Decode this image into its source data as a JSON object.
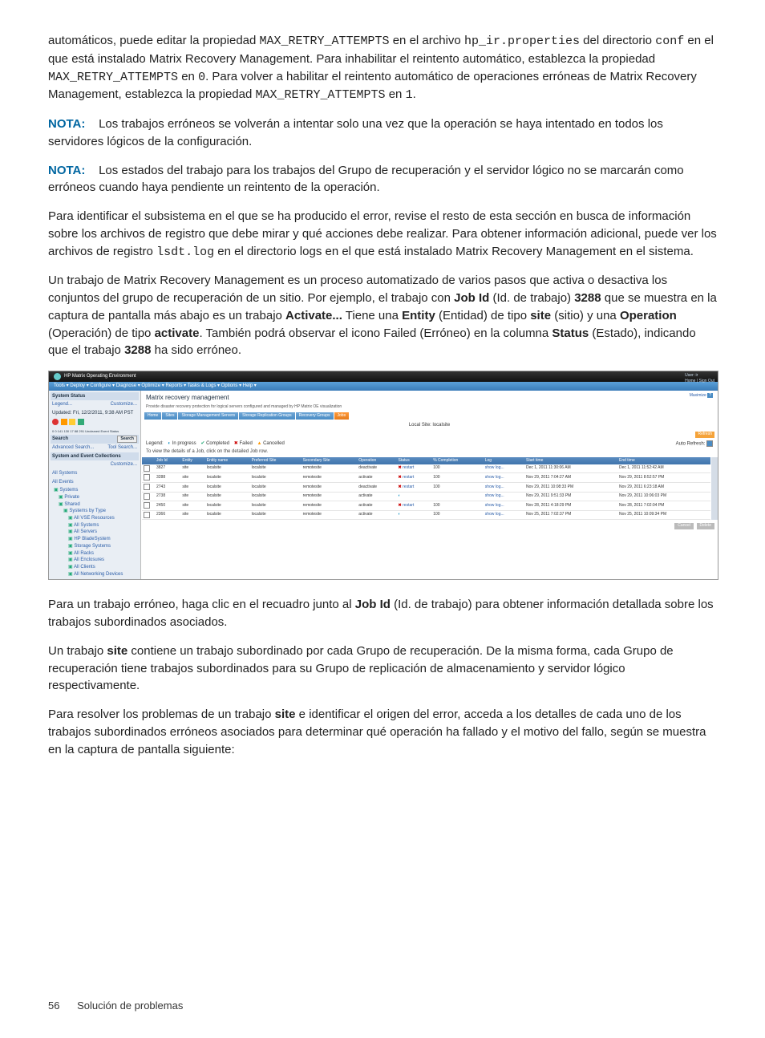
{
  "para1_a": "automáticos, puede editar la propiedad ",
  "para1_code1": "MAX_RETRY_ATTEMPTS",
  "para1_b": " en el archivo ",
  "para1_code2": "hp_ir.properties",
  "para1_c": " del directorio ",
  "para1_code3": "conf",
  "para1_d": " en el que está instalado Matrix Recovery Management. Para inhabilitar el reintento automático, establezca la propiedad ",
  "para1_code4": "MAX_RETRY_ATTEMPTS",
  "para1_e": " en ",
  "para1_code5": "0",
  "para1_f": ". Para volver a habilitar el reintento automático de operaciones erróneas de Matrix Recovery Management, establezca la propiedad ",
  "para1_code6": "MAX_RETRY_ATTEMPTS",
  "para1_g": " en ",
  "para1_code7": "1",
  "para1_h": ".",
  "nota_label": "NOTA:",
  "nota1_text": " Los trabajos erróneos se volverán a intentar solo una vez que la operación se haya intentado en todos los servidores lógicos de la configuración.",
  "nota2_text": " Los estados del trabajo para los trabajos del Grupo de recuperación y el servidor lógico no se marcarán como erróneos cuando haya pendiente un reintento de la operación.",
  "para2_a": "Para identificar el subsistema en el que se ha producido el error, revise el resto de esta sección en busca de información sobre los archivos de registro que debe mirar y qué acciones debe realizar. Para obtener información adicional, puede ver los archivos de registro ",
  "para2_code1": "lsdt.log",
  "para2_b": " en el directorio logs en el que está instalado Matrix Recovery Management en el sistema.",
  "para3_a": "Un trabajo de Matrix Recovery Management es un proceso automatizado de varios pasos que activa o desactiva los conjuntos del grupo de recuperación de un sitio. Por ejemplo, el trabajo con ",
  "para3_b1": "Job Id",
  "para3_c": " (Id. de trabajo) ",
  "para3_b2": "3288",
  "para3_d": " que se muestra en la captura de pantalla más abajo es un trabajo ",
  "para3_b3": "Activate...",
  "para3_e": " Tiene una ",
  "para3_b4": "Entity",
  "para3_f": " (Entidad) de tipo ",
  "para3_b5": "site",
  "para3_g": " (sitio) y una ",
  "para3_b6": "Operation",
  "para3_h": " (Operación) de tipo ",
  "para3_b7": "activate",
  "para3_i": ". También podrá observar el icono Failed (Erróneo) en la columna ",
  "para3_b8": "Status",
  "para3_j": " (Estado), indicando que el trabajo ",
  "para3_b9": "3288",
  "para3_k": " ha sido erróneo.",
  "ss": {
    "app_title": "HP Matrix Operating Environment",
    "user": "User: ir",
    "user_links": "Home | Sign Out",
    "menubar": "Tools ▾   Deploy ▾   Configure ▾   Diagnose ▾   Optimize ▾   Reports ▾   Tasks & Logs ▾   Options ▾   Help ▾",
    "side_status": "System Status",
    "side_legend": "Legend...",
    "side_custom": "Customize...",
    "side_updated": "Updated: Fri, 12/2/2011, 9:38 AM PST",
    "side_counts": "0 0 141 130 17 88 291 Uncleared Event Status",
    "side_search": "Search",
    "side_search_btn": "Search",
    "side_adv": "Advanced Search...",
    "side_tool": "Tool Search...",
    "side_collections": "System and Event Collections",
    "side_customize": "Customize...",
    "side_all_sys": "All Systems",
    "side_all_ev": "All Events",
    "tree": {
      "systems": "Systems",
      "private": "Private",
      "shared": "Shared",
      "by_type": "Systems by Type",
      "vse": "All VSE Resources",
      "all_sys": "All Systems",
      "servers": "All Servers",
      "blades": "HP BladeSystem",
      "storage": "Storage Systems",
      "racks": "All Racks",
      "enclosures": "All Enclosures",
      "clients": "All Clients",
      "netdev": "All Networking Devices"
    },
    "main_title": "Matrix recovery management",
    "main_sub": "Provide disaster recovery protection for logical servers configured and managed by HP Matrix OE visualization",
    "maximize": "Maximize",
    "tabs": [
      "Home",
      "Sites",
      "Storage Management Servers",
      "Storage Replication Groups",
      "Recovery Groups",
      "Jobs"
    ],
    "local_site": "Local Site: localsite",
    "refresh_btn": "Refresh",
    "auto_refresh": "Auto Refresh:",
    "legend": {
      "label": "Legend:",
      "in_progress": "In progress",
      "completed": "Completed",
      "failed": "Failed",
      "cancelled": "Cancelled"
    },
    "hint": "To view the details of a Job, click on the detailed Job row.",
    "columns": [
      "Job Id",
      "Entity",
      "Entity name",
      "Preferred Site",
      "Secondary Site",
      "Operation",
      "Status",
      "% Completion",
      "Log",
      "Start time",
      "End time"
    ],
    "rows": [
      {
        "id": "3827",
        "entity": "site",
        "ename": "localsite",
        "pref": "localsite",
        "sec": "remotesite",
        "op": "deactivate",
        "status": "fail",
        "status_text": "restart",
        "pct": "100",
        "log": "show log...",
        "start": "Dec 1, 2011 11:30:06 AM",
        "end": "Dec 1, 2011 11:52:42 AM"
      },
      {
        "id": "3288",
        "entity": "site",
        "ename": "localsite",
        "pref": "localsite",
        "sec": "remotesite",
        "op": "activate",
        "status": "fail",
        "status_text": "restart",
        "pct": "100",
        "log": "show log...",
        "start": "Nov 29, 2011 7:04:27 AM",
        "end": "Nov 29, 2011 8:52:57 PM"
      },
      {
        "id": "2743",
        "entity": "site",
        "ename": "localsite",
        "pref": "localsite",
        "sec": "remotesite",
        "op": "deactivate",
        "status": "fail",
        "status_text": "restart",
        "pct": "100",
        "log": "show log...",
        "start": "Nov 29, 2011 10:08:33 PM",
        "end": "Nov 29, 2011 6:23:18 AM"
      },
      {
        "id": "2738",
        "entity": "site",
        "ename": "localsite",
        "pref": "localsite",
        "sec": "remotesite",
        "op": "activate",
        "status": "run",
        "status_text": "",
        "pct": "",
        "log": "show log...",
        "start": "Nov 29, 2011 9:51:33 PM",
        "end": "Nov 29, 2011 10:06:03 PM"
      },
      {
        "id": "2450",
        "entity": "site",
        "ename": "localsite",
        "pref": "localsite",
        "sec": "remotesite",
        "op": "activate",
        "status": "fail",
        "status_text": "restart",
        "pct": "100",
        "log": "show log...",
        "start": "Nov 28, 2011 4:18:29 PM",
        "end": "Nov 28, 2011 7:02:04 PM"
      },
      {
        "id": "2366",
        "entity": "site",
        "ename": "localsite",
        "pref": "localsite",
        "sec": "remotesite",
        "op": "activate",
        "status": "run",
        "status_text": "",
        "pct": "100",
        "log": "show log...",
        "start": "Nov 25, 2011 7:02:37 PM",
        "end": "Nov 25, 2011 10:09:34 PM"
      }
    ],
    "btn_cancel": "Cancel",
    "btn_delete": "Delete"
  },
  "para4_a": "Para un trabajo erróneo, haga clic en el recuadro junto al ",
  "para4_b1": "Job Id",
  "para4_c": " (Id. de trabajo) para obtener información detallada sobre los trabajos subordinados asociados.",
  "para5_a": "Un trabajo ",
  "para5_b1": "site",
  "para5_b": " contiene un trabajo subordinado por cada Grupo de recuperación. De la misma forma, cada Grupo de recuperación tiene trabajos subordinados para su Grupo de replicación de almacenamiento y servidor lógico respectivamente.",
  "para6_a": "Para resolver los problemas de un trabajo ",
  "para6_b1": "site",
  "para6_b": " e identificar el origen del error, acceda a los detalles de cada uno de los trabajos subordinados erróneos asociados para determinar qué operación ha fallado y el motivo del fallo, según se muestra en la captura de pantalla siguiente:",
  "footer_page": "56",
  "footer_text": "Solución de problemas"
}
